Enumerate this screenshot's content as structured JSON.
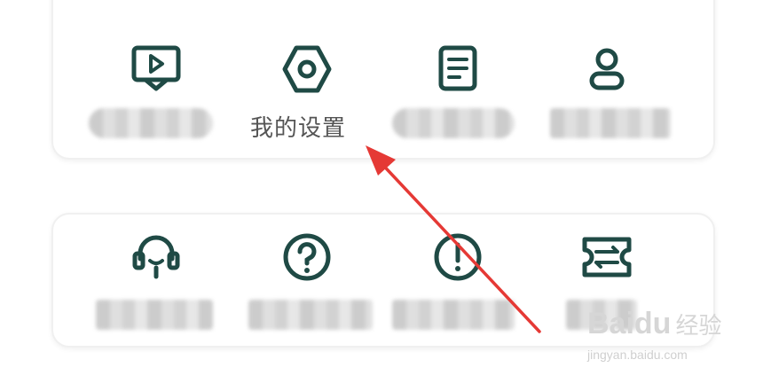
{
  "accent_color": "#1f4a45",
  "annotation_color": "#e53935",
  "top_card": {
    "items": [
      {
        "icon": "video-play-icon",
        "label_visible": false
      },
      {
        "icon": "settings-hex-icon",
        "label": "我的设置",
        "label_visible": true
      },
      {
        "icon": "document-icon",
        "label_visible": false
      },
      {
        "icon": "user-icon",
        "label_visible": false
      }
    ]
  },
  "bottom_card": {
    "items": [
      {
        "icon": "headset-icon",
        "label_visible": false
      },
      {
        "icon": "question-circle-icon",
        "label_visible": false
      },
      {
        "icon": "exclamation-circle-icon",
        "label_visible": false
      },
      {
        "icon": "ticket-exchange-icon",
        "label_visible": false
      }
    ]
  },
  "watermark": {
    "brand": "Baidu",
    "brand_cn": "经验",
    "url": "jingyan.baidu.com"
  }
}
